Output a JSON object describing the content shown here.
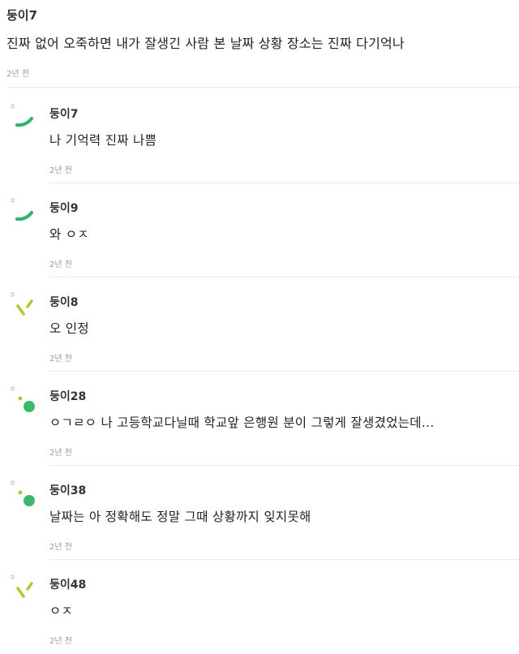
{
  "main_comment": {
    "author": "둥이7",
    "text": "진짜 없어 오죽하면 내가 잘생긴 사람 본 날짜 상황 장소는 진짜 다기억나",
    "time": "2년 전"
  },
  "replies": [
    {
      "author": "둥이7",
      "text": "나 기억력 진짜 나쁨",
      "time": "2년 전",
      "avatar": "arc-green-icon"
    },
    {
      "author": "둥이9",
      "text": "와 ㅇㅈ",
      "time": "2년 전",
      "avatar": "arc-green-icon"
    },
    {
      "author": "둥이8",
      "text": "오 인정",
      "time": "2년 전",
      "avatar": "lime-dashes-icon"
    },
    {
      "author": "둥이28",
      "text": "ㅇㄱㄹㅇ 나 고등학교다닐때 학교앞 은행원 분이 그렇게 잘생겼었는데...",
      "time": "2년 전",
      "avatar": "green-dots-icon"
    },
    {
      "author": "둥이38",
      "text": "날짜는 아 정확해도 정말 그때 상황까지 잊지못해",
      "time": "2년 전",
      "avatar": "green-dots-icon"
    },
    {
      "author": "둥이48",
      "text": "ㅇㅈ",
      "time": "2년 전",
      "avatar": "lime-dashes-icon"
    }
  ],
  "colors": {
    "green": "#2fb26c",
    "lime": "#a9cc2e",
    "dot_green": "#3cb96a"
  }
}
